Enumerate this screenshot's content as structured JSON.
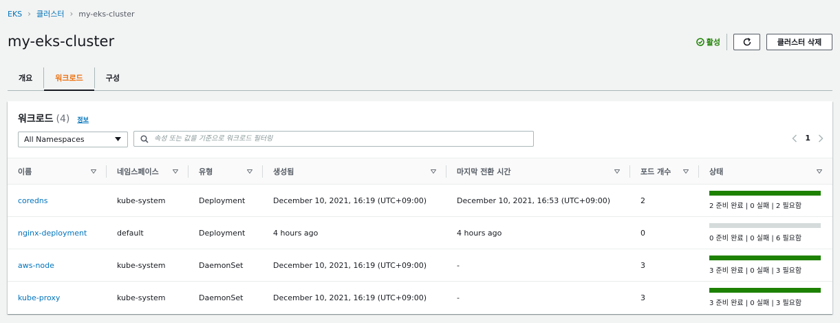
{
  "breadcrumb": {
    "root": "EKS",
    "clusters": "클러스터",
    "current": "my-eks-cluster"
  },
  "title": "my-eks-cluster",
  "header": {
    "status": "활성",
    "delete_label": "클러스터 삭제"
  },
  "tabs": [
    {
      "label": "개요",
      "active": false
    },
    {
      "label": "워크로드",
      "active": true
    },
    {
      "label": "구성",
      "active": false
    }
  ],
  "panel": {
    "title": "워크로드",
    "count": "(4)",
    "info": "정보",
    "namespace_select": "All Namespaces",
    "filter_placeholder": "속성 또는 값을 기준으로 워크로드 필터링",
    "page": "1"
  },
  "columns": [
    "이름",
    "네임스페이스",
    "유형",
    "생성됨",
    "마지막 전환 시간",
    "포드 개수",
    "상태"
  ],
  "rows": [
    {
      "name": "coredns",
      "namespace": "kube-system",
      "type": "Deployment",
      "created": "December 10, 2021, 16:19 (UTC+09:00)",
      "last_transition": "December 10, 2021, 16:53 (UTC+09:00)",
      "pods": "2",
      "ready_fraction": 1.0,
      "status": "2 준비 완료 | 0 실패 | 2 필요함"
    },
    {
      "name": "nginx-deployment",
      "namespace": "default",
      "type": "Deployment",
      "created": "4 hours ago",
      "last_transition": "4 hours ago",
      "pods": "0",
      "ready_fraction": 0.0,
      "status": "0 준비 완료 | 0 실패 | 6 필요함"
    },
    {
      "name": "aws-node",
      "namespace": "kube-system",
      "type": "DaemonSet",
      "created": "December 10, 2021, 16:19 (UTC+09:00)",
      "last_transition": "-",
      "pods": "3",
      "ready_fraction": 1.0,
      "status": "3 준비 완료 | 0 실패 | 3 필요함"
    },
    {
      "name": "kube-proxy",
      "namespace": "kube-system",
      "type": "DaemonSet",
      "created": "December 10, 2021, 16:19 (UTC+09:00)",
      "last_transition": "-",
      "pods": "3",
      "ready_fraction": 1.0,
      "status": "3 준비 완료 | 0 실패 | 3 필요함"
    }
  ],
  "colors": {
    "link": "#0073bb",
    "success": "#1d8102",
    "bar_fill": "#1d8102",
    "bar_empty": "#d5dbdb",
    "active_tab": "#ec7211"
  },
  "icons": {
    "status": "check-circle-icon",
    "refresh": "refresh-icon",
    "search": "search-icon",
    "caret": "caret-down-icon",
    "sort": "sort-icon",
    "prev": "chevron-left-icon",
    "next": "chevron-right-icon"
  }
}
